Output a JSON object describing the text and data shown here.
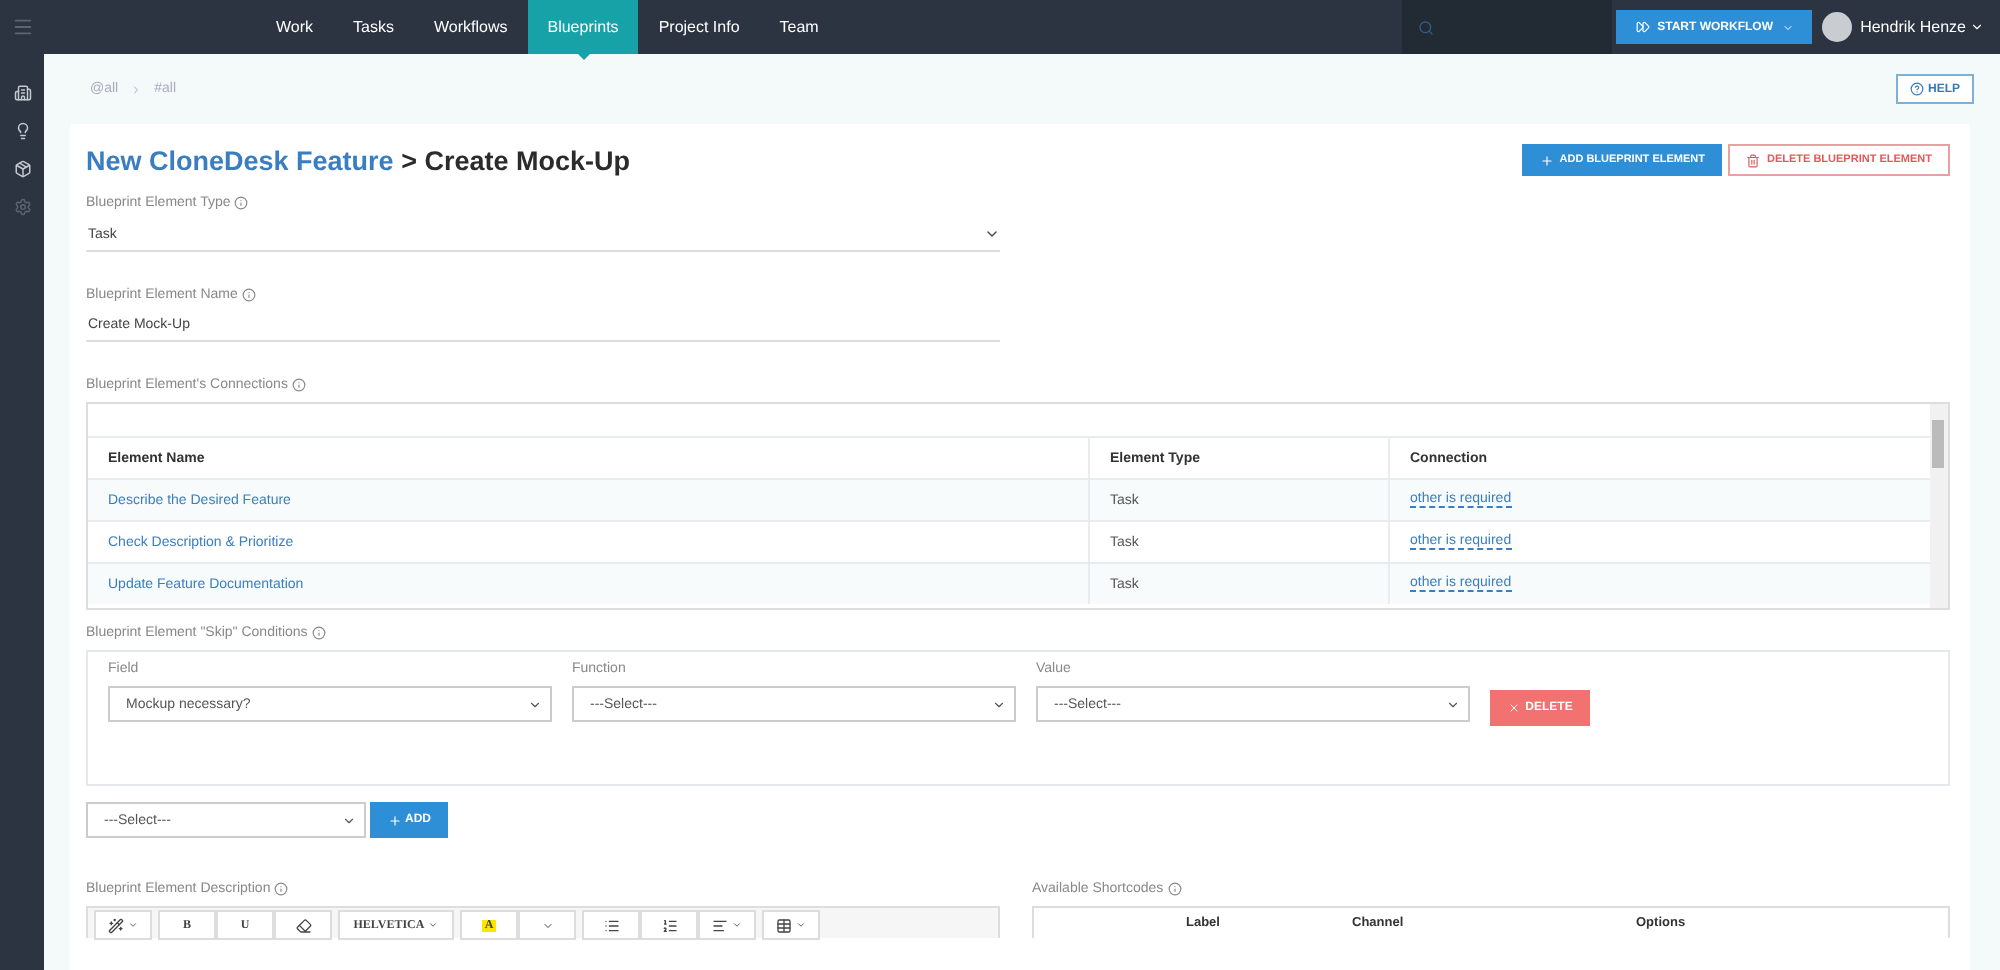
{
  "nav": {
    "items": [
      {
        "label": "Work",
        "selected": false
      },
      {
        "label": "Tasks",
        "selected": false
      },
      {
        "label": "Workflows",
        "selected": false
      },
      {
        "label": "Blueprints",
        "selected": true
      },
      {
        "label": "Project Info",
        "selected": false
      },
      {
        "label": "Team",
        "selected": false
      }
    ],
    "start_workflow": "START WORKFLOW",
    "user": "Hendrik Henze"
  },
  "breadcrumb": [
    "@all",
    "#all"
  ],
  "help": "HELP",
  "title": {
    "parent": "New CloneDesk Feature",
    "current": "> Create Mock-Up"
  },
  "actions": [
    {
      "kind": "add",
      "label": "ADD BLUEPRINT ELEMENT"
    },
    {
      "kind": "delete",
      "label": "DELETE BLUEPRINT ELEMENT"
    }
  ],
  "element_type": {
    "label": "Blueprint Element Type",
    "value": "Task"
  },
  "element_name": {
    "label": "Blueprint Element Name",
    "value": "Create Mock-Up"
  },
  "connections": {
    "label": "Blueprint Element's Connections",
    "columns": [
      "Element Name",
      "Element Type",
      "Connection"
    ],
    "rows": [
      {
        "name": "Describe the Desired Feature",
        "type": "Task",
        "connection": "other is required"
      },
      {
        "name": "Check Description & Prioritize",
        "type": "Task",
        "connection": "other is required"
      },
      {
        "name": "Update Feature Documentation",
        "type": "Task",
        "connection": "other is required"
      }
    ]
  },
  "skip_conditions": {
    "label": "Blueprint Element \"Skip\" Conditions",
    "conditions": [
      {
        "field": {
          "label": "Field",
          "value": "Mockup necessary?"
        },
        "function": {
          "label": "Function",
          "value": "---Select---"
        },
        "value": {
          "label": "Value",
          "value": "---Select---"
        },
        "delete": "DELETE"
      }
    ]
  },
  "add_condition": {
    "select": "---Select---",
    "button": "ADD"
  },
  "description": {
    "label": "Blueprint Element Description",
    "toolbar": [
      [
        {
          "kind": "wand",
          "dropdown": true
        }
      ],
      [
        {
          "kind": "text",
          "label": "B"
        },
        {
          "kind": "text",
          "label": "U"
        },
        {
          "kind": "eraser",
          "dropdown": false
        }
      ],
      [
        {
          "kind": "text",
          "label": "HELVETICA",
          "dropdown": true
        }
      ],
      [
        {
          "kind": "highlight",
          "label": "A"
        },
        {
          "kind": "caret"
        }
      ],
      [
        {
          "kind": "bullets",
          "dropdown": false
        },
        {
          "kind": "numbers",
          "dropdown": false
        },
        {
          "kind": "align",
          "dropdown": true
        }
      ],
      [
        {
          "kind": "table",
          "dropdown": true
        }
      ]
    ]
  },
  "shortcodes": {
    "label": "Available Shortcodes",
    "columns": [
      "Label",
      "Channel",
      "Options"
    ]
  }
}
